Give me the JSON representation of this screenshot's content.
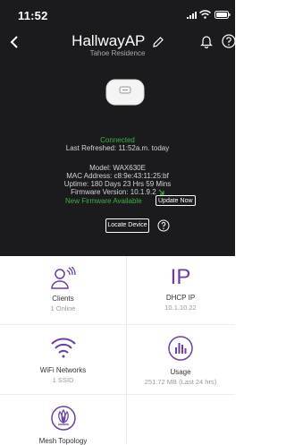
{
  "status_bar": {
    "time": "11:52"
  },
  "header": {
    "title": "HallwayAP",
    "subtitle": "Tahoe Residence"
  },
  "device_status": {
    "connected": "Connected",
    "last_refreshed": "Last Refreshed: 11:52a.m. today",
    "model": "Model: WAX630E",
    "mac": "MAC Address: c8:9e:43:11:25:bf",
    "uptime": "Uptime: 180 Days 23 Hrs 59 Mins",
    "firmware": "Firmware Version: 10.1.9.2",
    "firmware_new": "New Firmware Available",
    "update_button": "Update Now",
    "locate_button": "Locate Device"
  },
  "tiles": {
    "clients": {
      "label": "Clients",
      "sub": "1 Online"
    },
    "dhcp": {
      "icon_text": "IP",
      "label": "DHCP IP",
      "sub": "10.1.10.22"
    },
    "wifi": {
      "label": "WiFi Networks",
      "sub": "1 SSID"
    },
    "usage": {
      "label": "Usage",
      "sub": "251.72 MB (Last 24 hrs)"
    },
    "mesh": {
      "label": "Mesh Topology"
    }
  },
  "colors": {
    "accent": "#6a3fa6",
    "success": "#3fb040",
    "dark_bg": "#1b1b1d"
  }
}
